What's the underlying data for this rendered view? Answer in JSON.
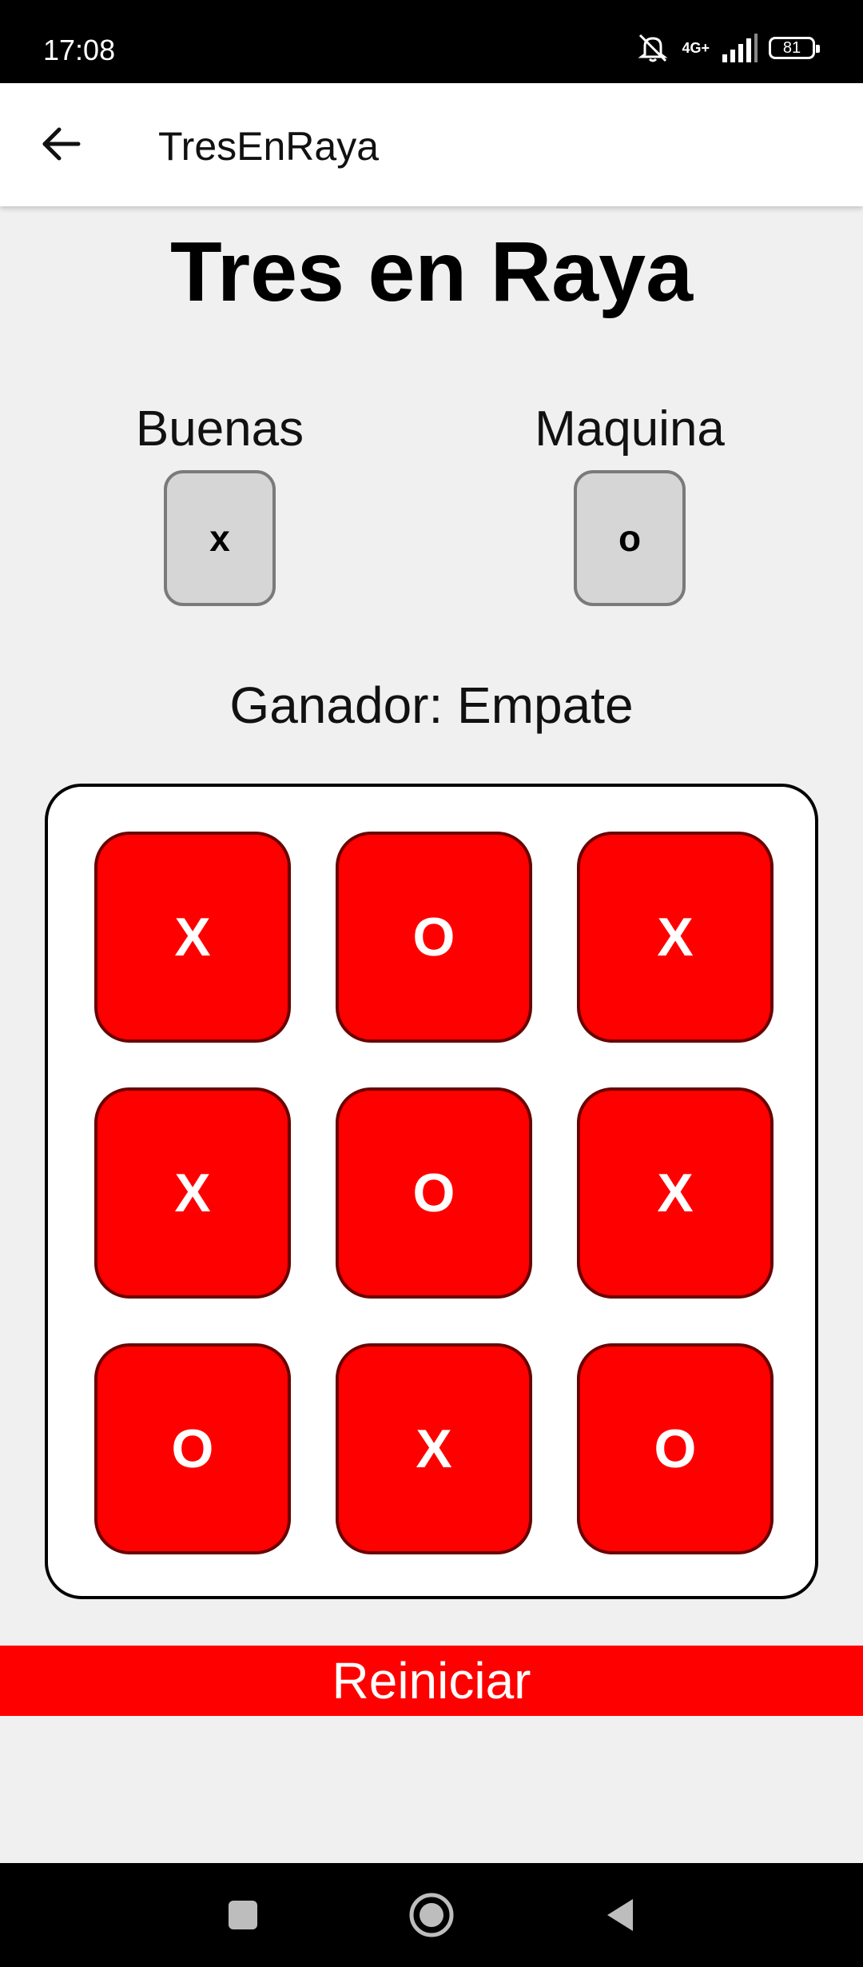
{
  "status_bar": {
    "time": "17:08",
    "network": "4G+",
    "battery": "81"
  },
  "app_bar": {
    "title": "TresEnRaya",
    "back_icon": "arrow-left-icon"
  },
  "game": {
    "title": "Tres en Raya",
    "players": [
      {
        "name": "Buenas",
        "symbol": "x"
      },
      {
        "name": "Maquina",
        "symbol": "o"
      }
    ],
    "winner_text": "Ganador: Empate",
    "board": [
      "X",
      "O",
      "X",
      "X",
      "O",
      "X",
      "O",
      "X",
      "O"
    ],
    "restart_label": "Reiniciar"
  },
  "colors": {
    "cell": "#ff0000",
    "restart": "#ff0000",
    "background": "#f0f0f0"
  }
}
